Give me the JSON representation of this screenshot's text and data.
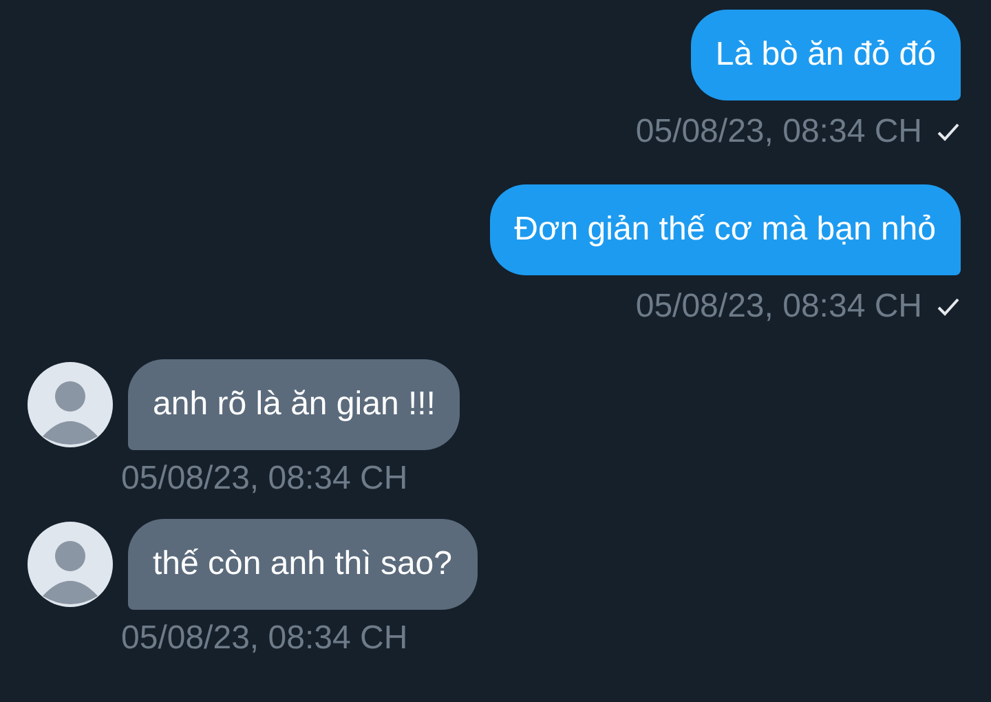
{
  "messages": [
    {
      "kind": "outgoing",
      "text": "Là bò ăn đỏ đó",
      "time": "05/08/23, 08:34 CH",
      "delivered": true
    },
    {
      "kind": "outgoing",
      "text": "Đơn giản thế cơ mà bạn nhỏ",
      "time": "05/08/23, 08:34 CH",
      "delivered": true
    },
    {
      "kind": "incoming",
      "text": "anh rõ là ăn gian !!!",
      "time": "05/08/23, 08:34 CH"
    },
    {
      "kind": "incoming",
      "text": "thế còn anh thì sao?",
      "time": "05/08/23, 08:34 CH"
    }
  ]
}
